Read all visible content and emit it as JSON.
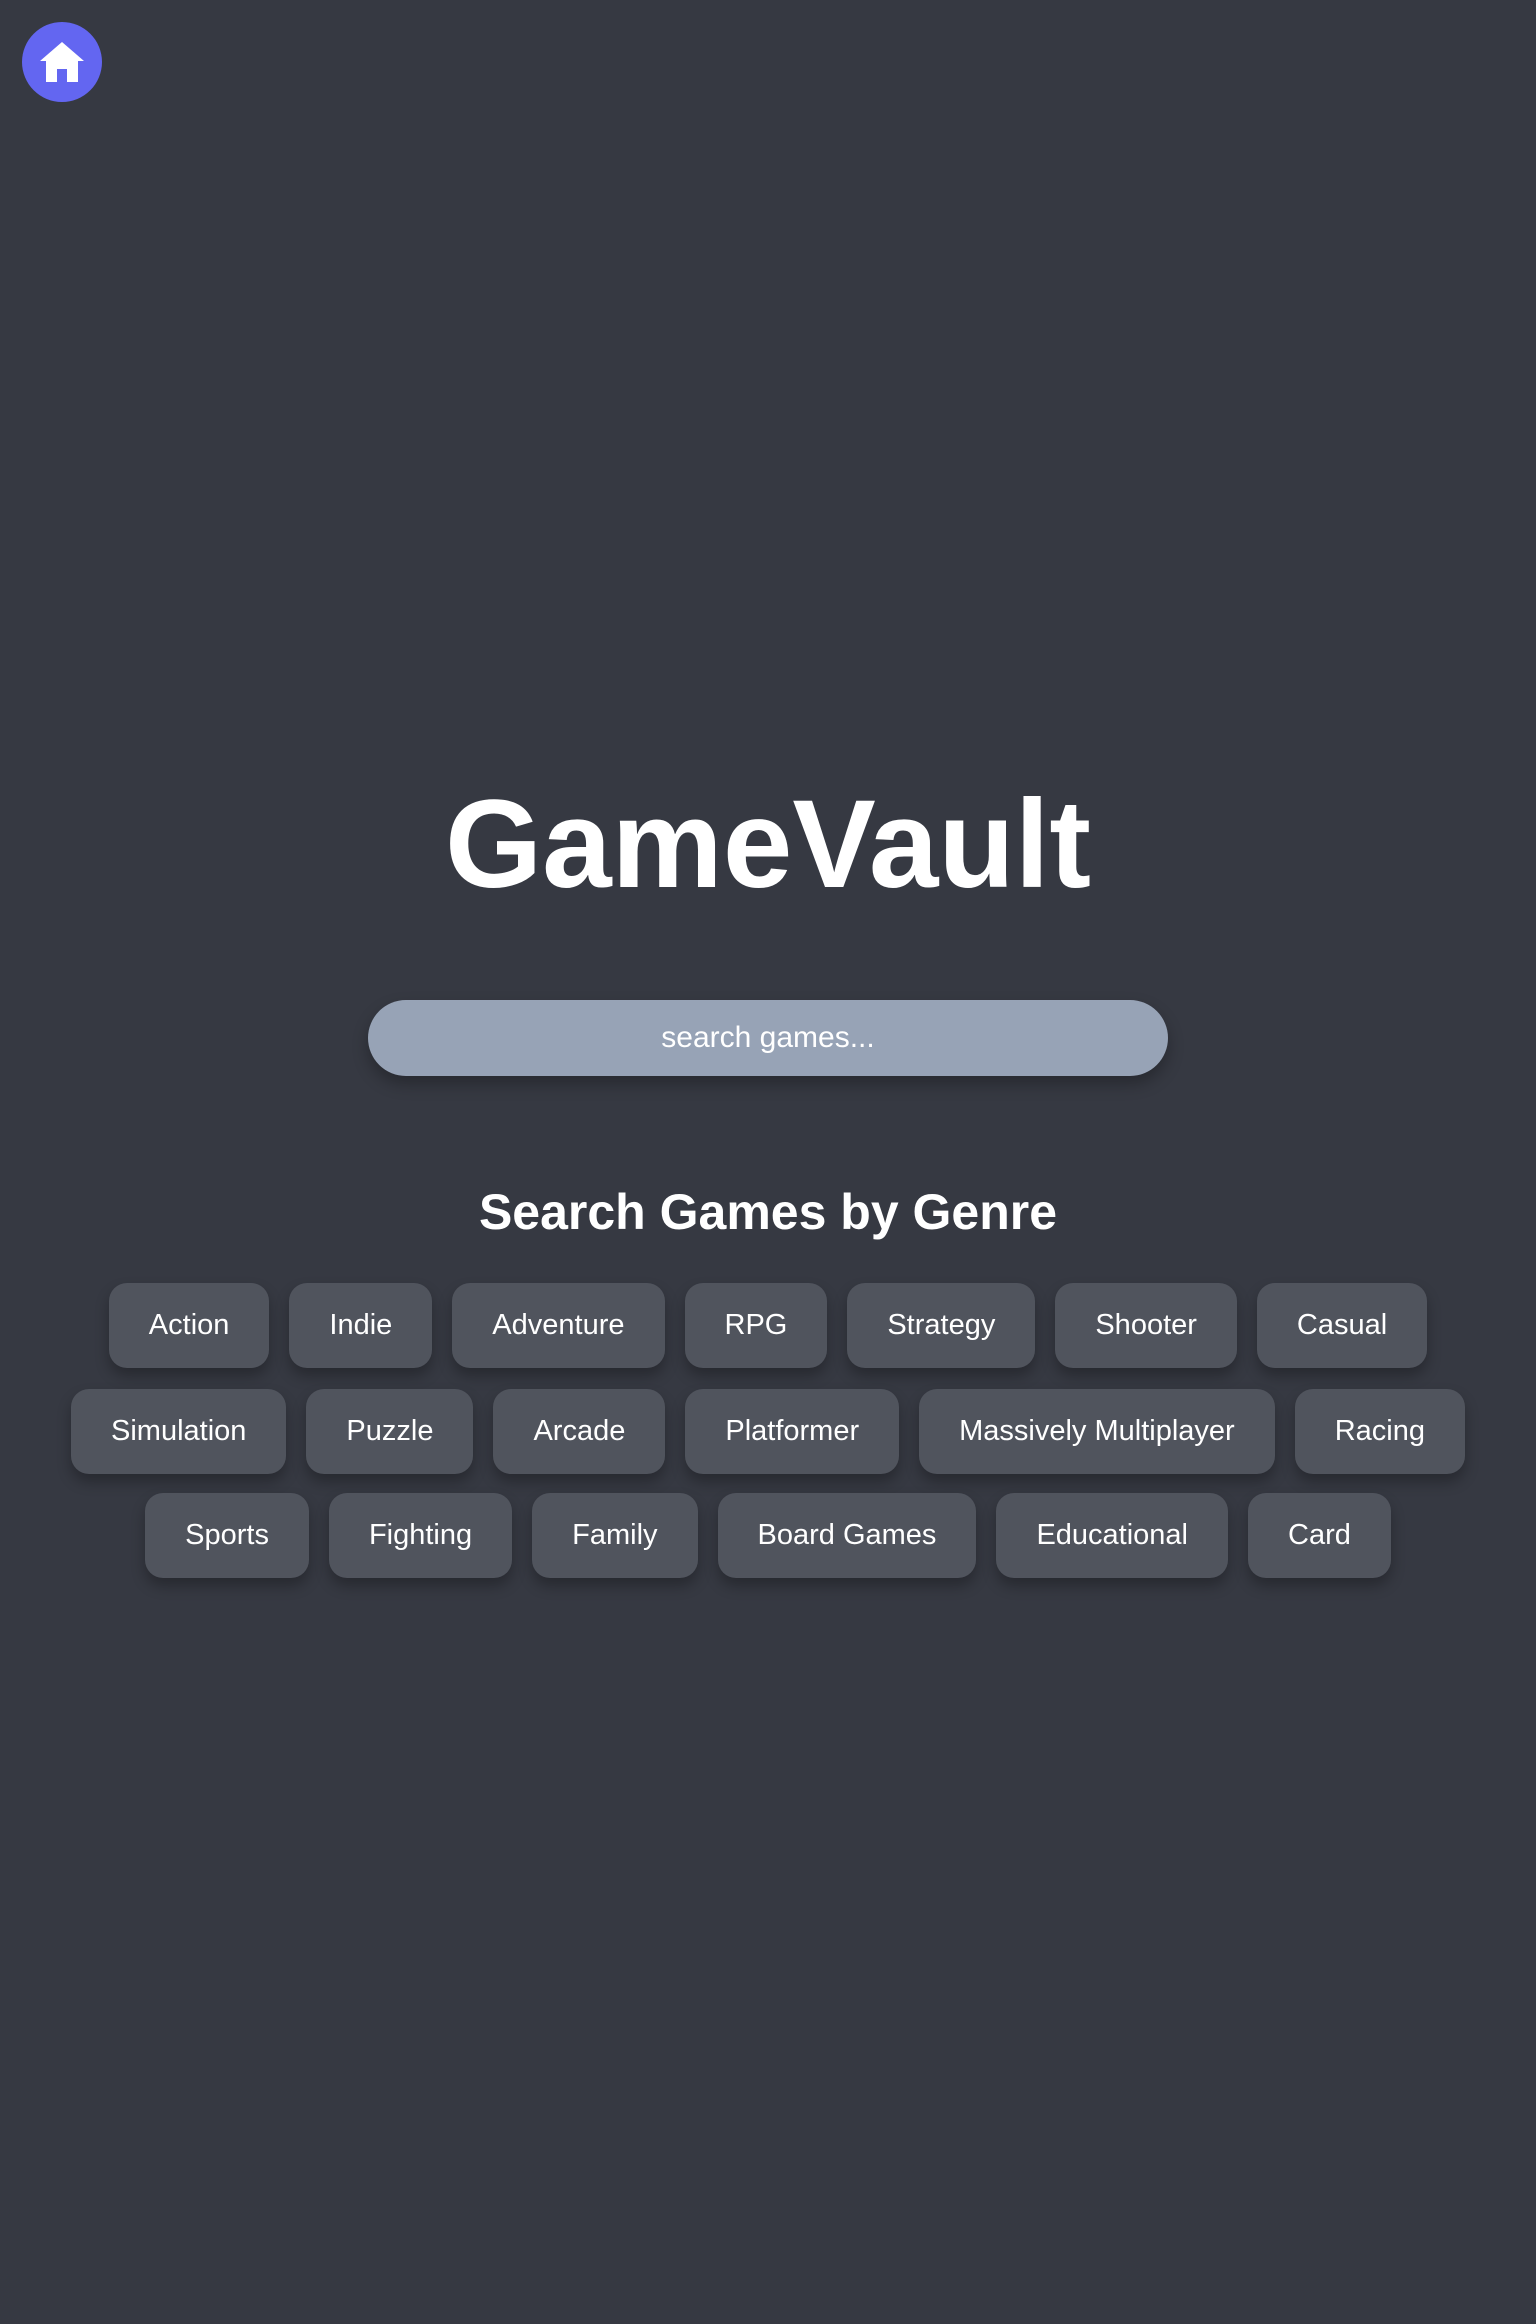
{
  "nav": {
    "home_icon": "home-icon",
    "home_icon_color": "#6366f1"
  },
  "header": {
    "title": "GameVault"
  },
  "search": {
    "placeholder": "search games..."
  },
  "genres": {
    "heading": "Search Games by Genre",
    "rows": [
      [
        "Action",
        "Indie",
        "Adventure",
        "RPG",
        "Strategy",
        "Shooter",
        "Casual"
      ],
      [
        "Simulation",
        "Puzzle",
        "Arcade",
        "Platformer",
        "Massively Multiplayer",
        "Racing"
      ],
      [
        "Sports",
        "Fighting",
        "Family",
        "Board Games",
        "Educational",
        "Card"
      ]
    ]
  },
  "colors": {
    "background": "#363942",
    "accent": "#6366f1",
    "search_background": "#97a3b6",
    "genre_button_background": "#50545d"
  }
}
